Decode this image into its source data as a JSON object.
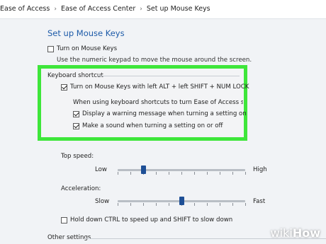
{
  "breadcrumb": {
    "items": [
      "Ease of Access",
      "Ease of Access Center",
      "Set up Mouse Keys"
    ],
    "separator": "›"
  },
  "page": {
    "title": "Set up Mouse Keys",
    "turn_on_label": "Turn on Mouse Keys",
    "turn_on_checked": false,
    "turn_on_description": "Use the numeric keypad to move the mouse around the screen."
  },
  "keyboard_shortcut": {
    "group_label": "Keyboard shortcut",
    "shortcut_label": "Turn on Mouse Keys with left ALT + left SHIFT + NUM LOCK",
    "shortcut_checked": true,
    "info_text": "When using keyboard shortcuts to turn Ease of Access settings o",
    "warning_label": "Display a warning message when turning a setting on",
    "warning_checked": true,
    "sound_label": "Make a sound when turning a setting on or off",
    "sound_checked": true
  },
  "pointer_speed": {
    "top_speed_label": "Top speed:",
    "top_low": "Low",
    "top_high": "High",
    "top_speed_value": 0.2,
    "acceleration_label": "Acceleration:",
    "acc_slow": "Slow",
    "acc_fast": "Fast",
    "acceleration_value": 0.5,
    "hold_ctrl_label": "Hold down CTRL to speed up and SHIFT to slow down",
    "hold_ctrl_checked": false
  },
  "other": {
    "label": "Other settings"
  },
  "watermark": {
    "wiki": "wiki",
    "how": "How"
  },
  "colors": {
    "highlight": "#3ee63a",
    "heading": "#1c5aa8",
    "slider_thumb": "#1e4f96"
  }
}
